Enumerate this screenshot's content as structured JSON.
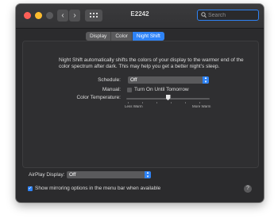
{
  "window": {
    "title": "E2242"
  },
  "search": {
    "placeholder": "Search"
  },
  "tabs": [
    {
      "label": "Display"
    },
    {
      "label": "Color"
    },
    {
      "label": "Night Shift",
      "active": true
    }
  ],
  "night_shift": {
    "description": "Night Shift automatically shifts the colors of your display to the warmer end of the color spectrum after dark. This may help you get a better night’s sleep.",
    "schedule_label": "Schedule:",
    "schedule_value": "Off",
    "manual_label": "Manual:",
    "manual_checkbox_label": "Turn On Until Tomorrow",
    "manual_checked": false,
    "color_temp_label": "Color Temperature:",
    "color_temp_level": 0.5,
    "less_warm_label": "Less Warm",
    "more_warm_label": "More Warm"
  },
  "airplay": {
    "label": "AirPlay Display:",
    "value": "Off"
  },
  "mirroring": {
    "label": "Show mirroring options in the menu bar when available",
    "checked": true
  },
  "help": {
    "label": "?"
  },
  "colors": {
    "accent": "#2e83f6",
    "background": "#2b2b2d"
  },
  "icons": [
    "close-icon",
    "minimize-icon",
    "zoom-icon",
    "back-icon",
    "forward-icon",
    "grid-icon",
    "search-icon",
    "chevron-updown-icon",
    "checkmark-icon",
    "help-icon"
  ]
}
